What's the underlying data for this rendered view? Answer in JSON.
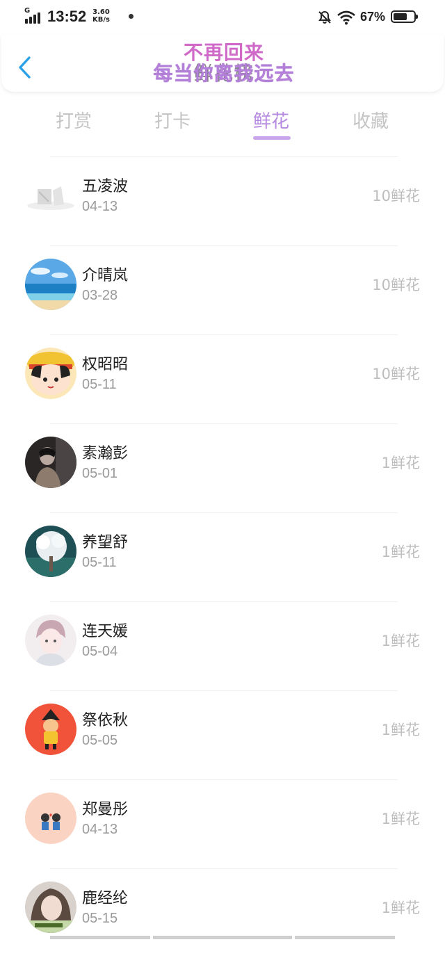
{
  "status_bar": {
    "network": "G",
    "time": "13:52",
    "speed_value": "3.60",
    "speed_unit": "KB/s",
    "battery_percent": "67%",
    "battery_level": 0.67
  },
  "header": {
    "back_icon": "chevron-left-icon",
    "title_line1": "不再回来",
    "title_line2": "每当你离我远去",
    "title_behind": "鲜花榜"
  },
  "tabs": [
    {
      "label": "打赏",
      "active": false
    },
    {
      "label": "打卡",
      "active": false
    },
    {
      "label": "鲜花",
      "active": true
    },
    {
      "label": "收藏",
      "active": false
    }
  ],
  "accent_color": "#b58ae0",
  "list": [
    {
      "name": "五凌波",
      "date": "04-13",
      "amount": "10鲜花",
      "avatar": "pale-sketch"
    },
    {
      "name": "介晴岚",
      "date": "03-28",
      "amount": "10鲜花",
      "avatar": "beach"
    },
    {
      "name": "权昭昭",
      "date": "05-11",
      "amount": "10鲜花",
      "avatar": "cartoon-girl"
    },
    {
      "name": "素瀚彭",
      "date": "05-01",
      "amount": "1鲜花",
      "avatar": "dark-photo"
    },
    {
      "name": "养望舒",
      "date": "05-11",
      "amount": "1鲜花",
      "avatar": "white-tree"
    },
    {
      "name": "连天媛",
      "date": "05-04",
      "amount": "1鲜花",
      "avatar": "anime-boy"
    },
    {
      "name": "祭依秋",
      "date": "05-05",
      "amount": "1鲜花",
      "avatar": "red-cartoon"
    },
    {
      "name": "郑曼彤",
      "date": "04-13",
      "amount": "1鲜花",
      "avatar": "couple-cartoon"
    },
    {
      "name": "鹿经纶",
      "date": "05-15",
      "amount": "1鲜花",
      "avatar": "girl-photo"
    }
  ]
}
